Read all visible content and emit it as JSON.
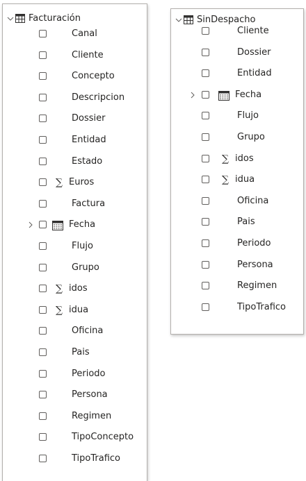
{
  "tables": [
    {
      "name": "Facturación",
      "fields": [
        {
          "label": "Canal",
          "type": "text"
        },
        {
          "label": "Cliente",
          "type": "text"
        },
        {
          "label": "Concepto",
          "type": "text"
        },
        {
          "label": "Descripcion",
          "type": "text"
        },
        {
          "label": "Dossier",
          "type": "text"
        },
        {
          "label": "Entidad",
          "type": "text"
        },
        {
          "label": "Estado",
          "type": "text"
        },
        {
          "label": "Euros",
          "type": "sum"
        },
        {
          "label": "Factura",
          "type": "text"
        },
        {
          "label": "Fecha",
          "type": "date"
        },
        {
          "label": "Flujo",
          "type": "text"
        },
        {
          "label": "Grupo",
          "type": "text"
        },
        {
          "label": "idos",
          "type": "sum"
        },
        {
          "label": "idua",
          "type": "sum"
        },
        {
          "label": "Oficina",
          "type": "text"
        },
        {
          "label": "Pais",
          "type": "text"
        },
        {
          "label": "Periodo",
          "type": "text"
        },
        {
          "label": "Persona",
          "type": "text"
        },
        {
          "label": "Regimen",
          "type": "text"
        },
        {
          "label": "TipoConcepto",
          "type": "text"
        },
        {
          "label": "TipoTrafico",
          "type": "text"
        }
      ]
    },
    {
      "name": "SinDespacho",
      "fields": [
        {
          "label": "Cliente",
          "type": "text"
        },
        {
          "label": "Dossier",
          "type": "text"
        },
        {
          "label": "Entidad",
          "type": "text"
        },
        {
          "label": "Fecha",
          "type": "date"
        },
        {
          "label": "Flujo",
          "type": "text"
        },
        {
          "label": "Grupo",
          "type": "text"
        },
        {
          "label": "idos",
          "type": "sum"
        },
        {
          "label": "idua",
          "type": "sum"
        },
        {
          "label": "Oficina",
          "type": "text"
        },
        {
          "label": "Pais",
          "type": "text"
        },
        {
          "label": "Periodo",
          "type": "text"
        },
        {
          "label": "Persona",
          "type": "text"
        },
        {
          "label": "Regimen",
          "type": "text"
        },
        {
          "label": "TipoTrafico",
          "type": "text"
        }
      ]
    }
  ],
  "icons": {
    "expanded": "chevron-down-icon",
    "collapsed": "chevron-right-icon",
    "table": "table-icon",
    "sum": "sigma-icon",
    "date": "calendar-icon"
  }
}
